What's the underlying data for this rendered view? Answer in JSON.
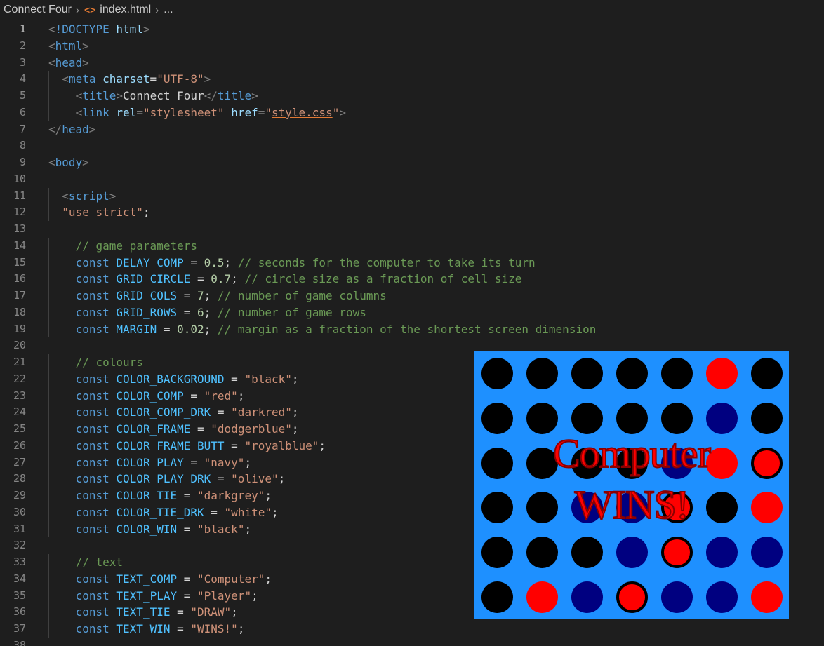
{
  "breadcrumb": {
    "folder": "Connect Four",
    "file_icon": "<>",
    "file": "index.html",
    "more": "..."
  },
  "editor": {
    "active_line": 1,
    "lines": [
      {
        "n": "1",
        "indent": 0,
        "tokens": [
          [
            "punc",
            "<"
          ],
          [
            "tag",
            "!DOCTYPE"
          ],
          [
            "text",
            " "
          ],
          [
            "attr",
            "html"
          ],
          [
            "punc",
            ">"
          ]
        ]
      },
      {
        "n": "2",
        "indent": 0,
        "tokens": [
          [
            "punc",
            "<"
          ],
          [
            "tag",
            "html"
          ],
          [
            "punc",
            ">"
          ]
        ]
      },
      {
        "n": "3",
        "indent": 0,
        "tokens": [
          [
            "punc",
            "<"
          ],
          [
            "tag",
            "head"
          ],
          [
            "punc",
            ">"
          ]
        ]
      },
      {
        "n": "4",
        "indent": 1,
        "tokens": [
          [
            "punc",
            "<"
          ],
          [
            "tag",
            "meta"
          ],
          [
            "text",
            " "
          ],
          [
            "attr",
            "charset"
          ],
          [
            "text",
            "="
          ],
          [
            "str",
            "\"UTF-8\""
          ],
          [
            "punc",
            ">"
          ]
        ]
      },
      {
        "n": "5",
        "indent": 2,
        "tokens": [
          [
            "punc",
            "<"
          ],
          [
            "tag",
            "title"
          ],
          [
            "punc",
            ">"
          ],
          [
            "text",
            "Connect Four"
          ],
          [
            "punc",
            "</"
          ],
          [
            "tag",
            "title"
          ],
          [
            "punc",
            ">"
          ]
        ]
      },
      {
        "n": "6",
        "indent": 2,
        "tokens": [
          [
            "punc",
            "<"
          ],
          [
            "tag",
            "link"
          ],
          [
            "text",
            " "
          ],
          [
            "attr",
            "rel"
          ],
          [
            "text",
            "="
          ],
          [
            "str",
            "\"stylesheet\""
          ],
          [
            "text",
            " "
          ],
          [
            "attr",
            "href"
          ],
          [
            "text",
            "="
          ],
          [
            "str",
            "\""
          ],
          [
            "strlink",
            "style.css"
          ],
          [
            "str",
            "\""
          ],
          [
            "punc",
            ">"
          ]
        ]
      },
      {
        "n": "7",
        "indent": 0,
        "tokens": [
          [
            "punc",
            "</"
          ],
          [
            "tag",
            "head"
          ],
          [
            "punc",
            ">"
          ]
        ]
      },
      {
        "n": "8",
        "indent": 0,
        "tokens": []
      },
      {
        "n": "9",
        "indent": 0,
        "tokens": [
          [
            "punc",
            "<"
          ],
          [
            "tag",
            "body"
          ],
          [
            "punc",
            ">"
          ]
        ]
      },
      {
        "n": "10",
        "indent": 0,
        "tokens": []
      },
      {
        "n": "11",
        "indent": 1,
        "tokens": [
          [
            "punc",
            "<"
          ],
          [
            "tag",
            "script"
          ],
          [
            "punc",
            ">"
          ]
        ]
      },
      {
        "n": "12",
        "indent": 1,
        "tokens": [
          [
            "str",
            "\"use strict\""
          ],
          [
            "text",
            ";"
          ]
        ]
      },
      {
        "n": "13",
        "indent": 0,
        "tokens": []
      },
      {
        "n": "14",
        "indent": 2,
        "tokens": [
          [
            "cmt",
            "// game parameters"
          ]
        ]
      },
      {
        "n": "15",
        "indent": 2,
        "tokens": [
          [
            "kw",
            "const"
          ],
          [
            "text",
            " "
          ],
          [
            "const",
            "DELAY_COMP"
          ],
          [
            "text",
            " = "
          ],
          [
            "num",
            "0.5"
          ],
          [
            "text",
            "; "
          ],
          [
            "cmt",
            "// seconds for the computer to take its turn"
          ]
        ]
      },
      {
        "n": "16",
        "indent": 2,
        "tokens": [
          [
            "kw",
            "const"
          ],
          [
            "text",
            " "
          ],
          [
            "const",
            "GRID_CIRCLE"
          ],
          [
            "text",
            " = "
          ],
          [
            "num",
            "0.7"
          ],
          [
            "text",
            "; "
          ],
          [
            "cmt",
            "// circle size as a fraction of cell size"
          ]
        ]
      },
      {
        "n": "17",
        "indent": 2,
        "tokens": [
          [
            "kw",
            "const"
          ],
          [
            "text",
            " "
          ],
          [
            "const",
            "GRID_COLS"
          ],
          [
            "text",
            " = "
          ],
          [
            "num",
            "7"
          ],
          [
            "text",
            "; "
          ],
          [
            "cmt",
            "// number of game columns"
          ]
        ]
      },
      {
        "n": "18",
        "indent": 2,
        "tokens": [
          [
            "kw",
            "const"
          ],
          [
            "text",
            " "
          ],
          [
            "const",
            "GRID_ROWS"
          ],
          [
            "text",
            " = "
          ],
          [
            "num",
            "6"
          ],
          [
            "text",
            "; "
          ],
          [
            "cmt",
            "// number of game rows"
          ]
        ]
      },
      {
        "n": "19",
        "indent": 2,
        "tokens": [
          [
            "kw",
            "const"
          ],
          [
            "text",
            " "
          ],
          [
            "const",
            "MARGIN"
          ],
          [
            "text",
            " = "
          ],
          [
            "num",
            "0.02"
          ],
          [
            "text",
            "; "
          ],
          [
            "cmt",
            "// margin as a fraction of the shortest screen dimension"
          ]
        ]
      },
      {
        "n": "20",
        "indent": 0,
        "tokens": []
      },
      {
        "n": "21",
        "indent": 2,
        "tokens": [
          [
            "cmt",
            "// colours"
          ]
        ]
      },
      {
        "n": "22",
        "indent": 2,
        "tokens": [
          [
            "kw",
            "const"
          ],
          [
            "text",
            " "
          ],
          [
            "const",
            "COLOR_BACKGROUND"
          ],
          [
            "text",
            " = "
          ],
          [
            "str",
            "\"black\""
          ],
          [
            "text",
            ";"
          ]
        ]
      },
      {
        "n": "23",
        "indent": 2,
        "tokens": [
          [
            "kw",
            "const"
          ],
          [
            "text",
            " "
          ],
          [
            "const",
            "COLOR_COMP"
          ],
          [
            "text",
            " = "
          ],
          [
            "str",
            "\"red\""
          ],
          [
            "text",
            ";"
          ]
        ]
      },
      {
        "n": "24",
        "indent": 2,
        "tokens": [
          [
            "kw",
            "const"
          ],
          [
            "text",
            " "
          ],
          [
            "const",
            "COLOR_COMP_DRK"
          ],
          [
            "text",
            " = "
          ],
          [
            "str",
            "\"darkred\""
          ],
          [
            "text",
            ";"
          ]
        ]
      },
      {
        "n": "25",
        "indent": 2,
        "tokens": [
          [
            "kw",
            "const"
          ],
          [
            "text",
            " "
          ],
          [
            "const",
            "COLOR_FRAME"
          ],
          [
            "text",
            " = "
          ],
          [
            "str",
            "\"dodgerblue\""
          ],
          [
            "text",
            ";"
          ]
        ]
      },
      {
        "n": "26",
        "indent": 2,
        "tokens": [
          [
            "kw",
            "const"
          ],
          [
            "text",
            " "
          ],
          [
            "const",
            "COLOR_FRAME_BUTT"
          ],
          [
            "text",
            " = "
          ],
          [
            "str",
            "\"royalblue\""
          ],
          [
            "text",
            ";"
          ]
        ]
      },
      {
        "n": "27",
        "indent": 2,
        "tokens": [
          [
            "kw",
            "const"
          ],
          [
            "text",
            " "
          ],
          [
            "const",
            "COLOR_PLAY"
          ],
          [
            "text",
            " = "
          ],
          [
            "str",
            "\"navy\""
          ],
          [
            "text",
            ";"
          ]
        ]
      },
      {
        "n": "28",
        "indent": 2,
        "tokens": [
          [
            "kw",
            "const"
          ],
          [
            "text",
            " "
          ],
          [
            "const",
            "COLOR_PLAY_DRK"
          ],
          [
            "text",
            " = "
          ],
          [
            "str",
            "\"olive\""
          ],
          [
            "text",
            ";"
          ]
        ]
      },
      {
        "n": "29",
        "indent": 2,
        "tokens": [
          [
            "kw",
            "const"
          ],
          [
            "text",
            " "
          ],
          [
            "const",
            "COLOR_TIE"
          ],
          [
            "text",
            " = "
          ],
          [
            "str",
            "\"darkgrey\""
          ],
          [
            "text",
            ";"
          ]
        ]
      },
      {
        "n": "30",
        "indent": 2,
        "tokens": [
          [
            "kw",
            "const"
          ],
          [
            "text",
            " "
          ],
          [
            "const",
            "COLOR_TIE_DRK"
          ],
          [
            "text",
            " = "
          ],
          [
            "str",
            "\"white\""
          ],
          [
            "text",
            ";"
          ]
        ]
      },
      {
        "n": "31",
        "indent": 2,
        "tokens": [
          [
            "kw",
            "const"
          ],
          [
            "text",
            " "
          ],
          [
            "const",
            "COLOR_WIN"
          ],
          [
            "text",
            " = "
          ],
          [
            "str",
            "\"black\""
          ],
          [
            "text",
            ";"
          ]
        ]
      },
      {
        "n": "32",
        "indent": 0,
        "tokens": []
      },
      {
        "n": "33",
        "indent": 2,
        "tokens": [
          [
            "cmt",
            "// text"
          ]
        ]
      },
      {
        "n": "34",
        "indent": 2,
        "tokens": [
          [
            "kw",
            "const"
          ],
          [
            "text",
            " "
          ],
          [
            "const",
            "TEXT_COMP"
          ],
          [
            "text",
            " = "
          ],
          [
            "str",
            "\"Computer\""
          ],
          [
            "text",
            ";"
          ]
        ]
      },
      {
        "n": "35",
        "indent": 2,
        "tokens": [
          [
            "kw",
            "const"
          ],
          [
            "text",
            " "
          ],
          [
            "const",
            "TEXT_PLAY"
          ],
          [
            "text",
            " = "
          ],
          [
            "str",
            "\"Player\""
          ],
          [
            "text",
            ";"
          ]
        ]
      },
      {
        "n": "36",
        "indent": 2,
        "tokens": [
          [
            "kw",
            "const"
          ],
          [
            "text",
            " "
          ],
          [
            "const",
            "TEXT_TIE"
          ],
          [
            "text",
            " = "
          ],
          [
            "str",
            "\"DRAW\""
          ],
          [
            "text",
            ";"
          ]
        ]
      },
      {
        "n": "37",
        "indent": 2,
        "tokens": [
          [
            "kw",
            "const"
          ],
          [
            "text",
            " "
          ],
          [
            "const",
            "TEXT_WIN"
          ],
          [
            "text",
            " = "
          ],
          [
            "str",
            "\"WINS!\""
          ],
          [
            "text",
            ";"
          ]
        ]
      },
      {
        "n": "38",
        "indent": 0,
        "tokens": []
      }
    ]
  },
  "game": {
    "frame_color": "#1e90ff",
    "text_color": "#ff0000",
    "text_outline_color": "#8b0000",
    "winner_text": "Computer",
    "win_text": "WINS!",
    "grid": [
      [
        "black",
        "black",
        "black",
        "black",
        "black",
        "red",
        "black"
      ],
      [
        "black",
        "black",
        "black",
        "black",
        "black",
        "navy",
        "black"
      ],
      [
        "black",
        "black",
        "black",
        "black",
        "navy",
        "red",
        "red-win"
      ],
      [
        "black",
        "black",
        "navy",
        "navy",
        "red-win",
        "black",
        "red"
      ],
      [
        "black",
        "black",
        "black",
        "navy",
        "red-win",
        "navy",
        "navy"
      ],
      [
        "black",
        "red",
        "navy",
        "red-win",
        "navy",
        "navy",
        "red"
      ]
    ]
  }
}
